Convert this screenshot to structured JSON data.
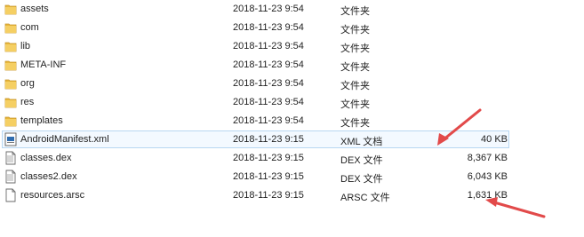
{
  "files": [
    {
      "name": "assets",
      "date": "2018-11-23 9:54",
      "type": "文件夹",
      "size": "",
      "icon": "folder-icon"
    },
    {
      "name": "com",
      "date": "2018-11-23 9:54",
      "type": "文件夹",
      "size": "",
      "icon": "folder-icon"
    },
    {
      "name": "lib",
      "date": "2018-11-23 9:54",
      "type": "文件夹",
      "size": "",
      "icon": "folder-icon"
    },
    {
      "name": "META-INF",
      "date": "2018-11-23 9:54",
      "type": "文件夹",
      "size": "",
      "icon": "folder-icon"
    },
    {
      "name": "org",
      "date": "2018-11-23 9:54",
      "type": "文件夹",
      "size": "",
      "icon": "folder-icon"
    },
    {
      "name": "res",
      "date": "2018-11-23 9:54",
      "type": "文件夹",
      "size": "",
      "icon": "folder-icon"
    },
    {
      "name": "templates",
      "date": "2018-11-23 9:54",
      "type": "文件夹",
      "size": "",
      "icon": "folder-icon"
    },
    {
      "name": "AndroidManifest.xml",
      "date": "2018-11-23 9:15",
      "type": "XML 文档",
      "size": "40 KB",
      "icon": "xml-file-icon"
    },
    {
      "name": "classes.dex",
      "date": "2018-11-23 9:15",
      "type": "DEX 文件",
      "size": "8,367 KB",
      "icon": "file-icon"
    },
    {
      "name": "classes2.dex",
      "date": "2018-11-23 9:15",
      "type": "DEX 文件",
      "size": "6,043 KB",
      "icon": "file-icon"
    },
    {
      "name": "resources.arsc",
      "date": "2018-11-23 9:15",
      "type": "ARSC 文件",
      "size": "1,631 KB",
      "icon": "file-icon"
    }
  ],
  "colors": {
    "folder": "#e8b83c",
    "selection_border": "#b7d7f2",
    "annotation_arrow": "#e24a4a"
  }
}
